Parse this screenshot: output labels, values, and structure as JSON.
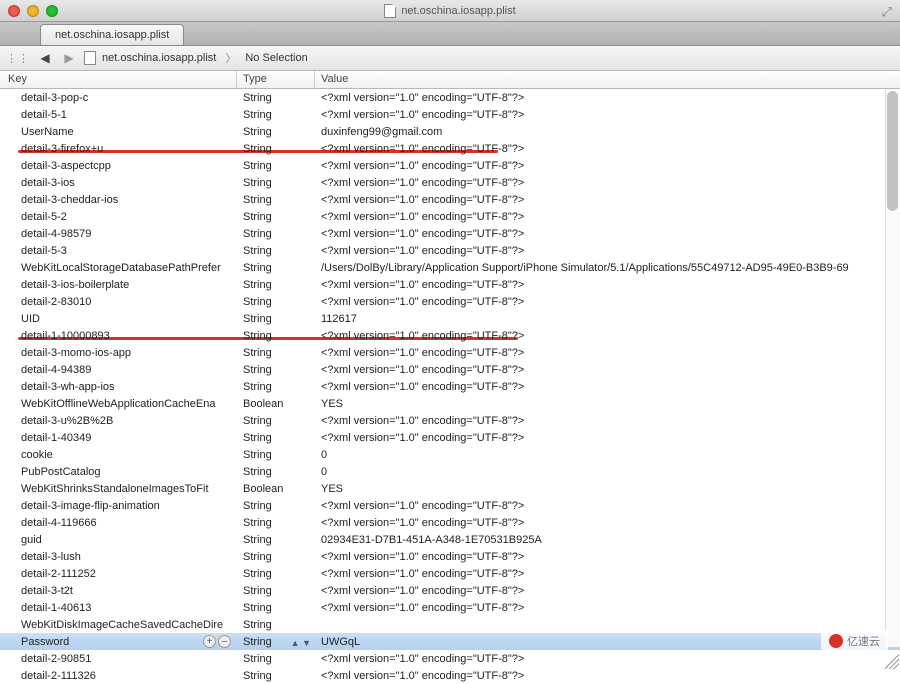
{
  "window": {
    "title": "net.oschina.iosapp.plist"
  },
  "tab": {
    "label": "net.oschina.iosapp.plist"
  },
  "breadcrumb": {
    "file": "net.oschina.iosapp.plist",
    "selection": "No Selection"
  },
  "columns": {
    "key": "Key",
    "type": "Type",
    "value": "Value"
  },
  "xml_decl": "<?xml version=\"1.0\" encoding=\"UTF-8\"?>",
  "rows": [
    {
      "key": "detail-3-pop-c",
      "type": "String",
      "value_ref": "xml_decl"
    },
    {
      "key": "detail-5-1",
      "type": "String",
      "value_ref": "xml_decl"
    },
    {
      "key": "UserName",
      "type": "String",
      "value": "duxinfeng99@gmail.com"
    },
    {
      "key": "detail-3-firefox+u",
      "type": "String",
      "value_ref": "xml_decl"
    },
    {
      "key": "detail-3-aspectcpp",
      "type": "String",
      "value_ref": "xml_decl"
    },
    {
      "key": "detail-3-ios",
      "type": "String",
      "value_ref": "xml_decl"
    },
    {
      "key": "detail-3-cheddar-ios",
      "type": "String",
      "value_ref": "xml_decl"
    },
    {
      "key": "detail-5-2",
      "type": "String",
      "value_ref": "xml_decl"
    },
    {
      "key": "detail-4-98579",
      "type": "String",
      "value_ref": "xml_decl"
    },
    {
      "key": "detail-5-3",
      "type": "String",
      "value_ref": "xml_decl"
    },
    {
      "key": "WebKitLocalStorageDatabasePathPrefer",
      "type": "String",
      "value": "/Users/DolBy/Library/Application Support/iPhone Simulator/5.1/Applications/55C49712-AD95-49E0-B3B9-69"
    },
    {
      "key": "detail-3-ios-boilerplate",
      "type": "String",
      "value_ref": "xml_decl"
    },
    {
      "key": "detail-2-83010",
      "type": "String",
      "value_ref": "xml_decl"
    },
    {
      "key": "UID",
      "type": "String",
      "value": "112617"
    },
    {
      "key": "detail-1-10000893",
      "type": "String",
      "value_ref": "xml_decl"
    },
    {
      "key": "detail-3-momo-ios-app",
      "type": "String",
      "value_ref": "xml_decl"
    },
    {
      "key": "detail-4-94389",
      "type": "String",
      "value_ref": "xml_decl"
    },
    {
      "key": "detail-3-wh-app-ios",
      "type": "String",
      "value_ref": "xml_decl"
    },
    {
      "key": "WebKitOfflineWebApplicationCacheEna",
      "type": "Boolean",
      "value": "YES"
    },
    {
      "key": "detail-3-u%2B%2B",
      "type": "String",
      "value_ref": "xml_decl"
    },
    {
      "key": "detail-1-40349",
      "type": "String",
      "value_ref": "xml_decl"
    },
    {
      "key": "cookie",
      "type": "String",
      "value": "0"
    },
    {
      "key": "PubPostCatalog",
      "type": "String",
      "value": "0"
    },
    {
      "key": "WebKitShrinksStandaloneImagesToFit",
      "type": "Boolean",
      "value": "YES"
    },
    {
      "key": "detail-3-image-flip-animation",
      "type": "String",
      "value_ref": "xml_decl"
    },
    {
      "key": "detail-4-119666",
      "type": "String",
      "value_ref": "xml_decl"
    },
    {
      "key": "guid",
      "type": "String",
      "value": "02934E31-D7B1-451A-A348-1E70531B925A"
    },
    {
      "key": "detail-3-lush",
      "type": "String",
      "value_ref": "xml_decl"
    },
    {
      "key": "detail-2-111252",
      "type": "String",
      "value_ref": "xml_decl"
    },
    {
      "key": "detail-3-t2t",
      "type": "String",
      "value_ref": "xml_decl"
    },
    {
      "key": "detail-1-40613",
      "type": "String",
      "value_ref": "xml_decl"
    },
    {
      "key": "WebKitDiskImageCacheSavedCacheDire",
      "type": "String",
      "value": ""
    },
    {
      "key": "Password",
      "type": "String",
      "value": "UWGqL",
      "selected": true,
      "editing": true
    },
    {
      "key": "detail-2-90851",
      "type": "String",
      "value_ref": "xml_decl"
    },
    {
      "key": "detail-2-111326",
      "type": "String",
      "value_ref": "xml_decl_partial"
    }
  ],
  "xml_decl_partial": "<?xml version=\"1.0\" encoding=\"UTF-8\"?>",
  "watermark": "亿速云"
}
